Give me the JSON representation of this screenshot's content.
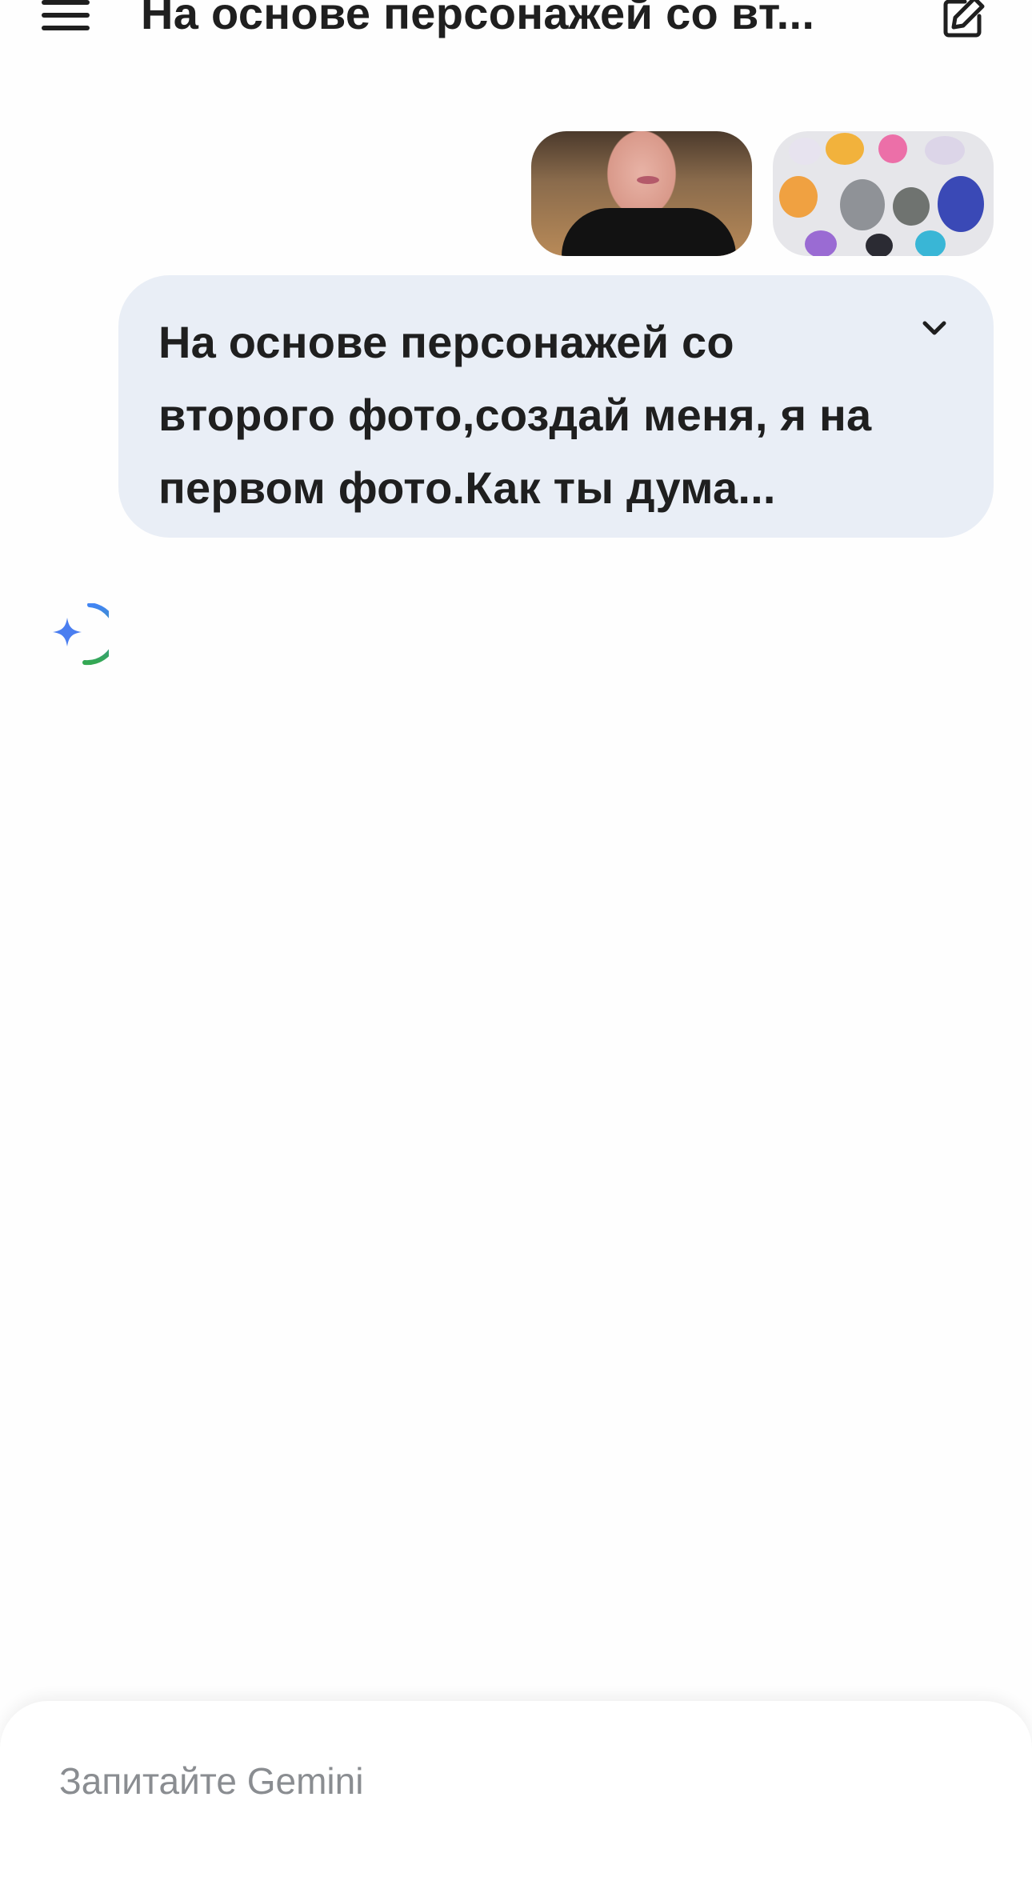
{
  "header": {
    "title": "На основе персонажей со вт...",
    "menu_icon": "hamburger-menu-icon",
    "edit_icon": "new-chat-edit-icon"
  },
  "message": {
    "attachments": [
      {
        "name": "attachment-photo-person"
      },
      {
        "name": "attachment-photo-ponies"
      }
    ],
    "text": "На основе персонажей со второго фото,создай меня, я на первом фото.Как ты дума...",
    "expand_icon": "chevron-down-icon"
  },
  "response": {
    "loading_icon": "gemini-sparkle-spinner-icon"
  },
  "input": {
    "placeholder": "Запитайте Gemini",
    "value": ""
  },
  "colors": {
    "bubble": "#e9eef6",
    "text": "#1f1f1f",
    "placeholder": "#8a8d91",
    "gemini_blue": "#4285f4",
    "gemini_green": "#34a853"
  }
}
